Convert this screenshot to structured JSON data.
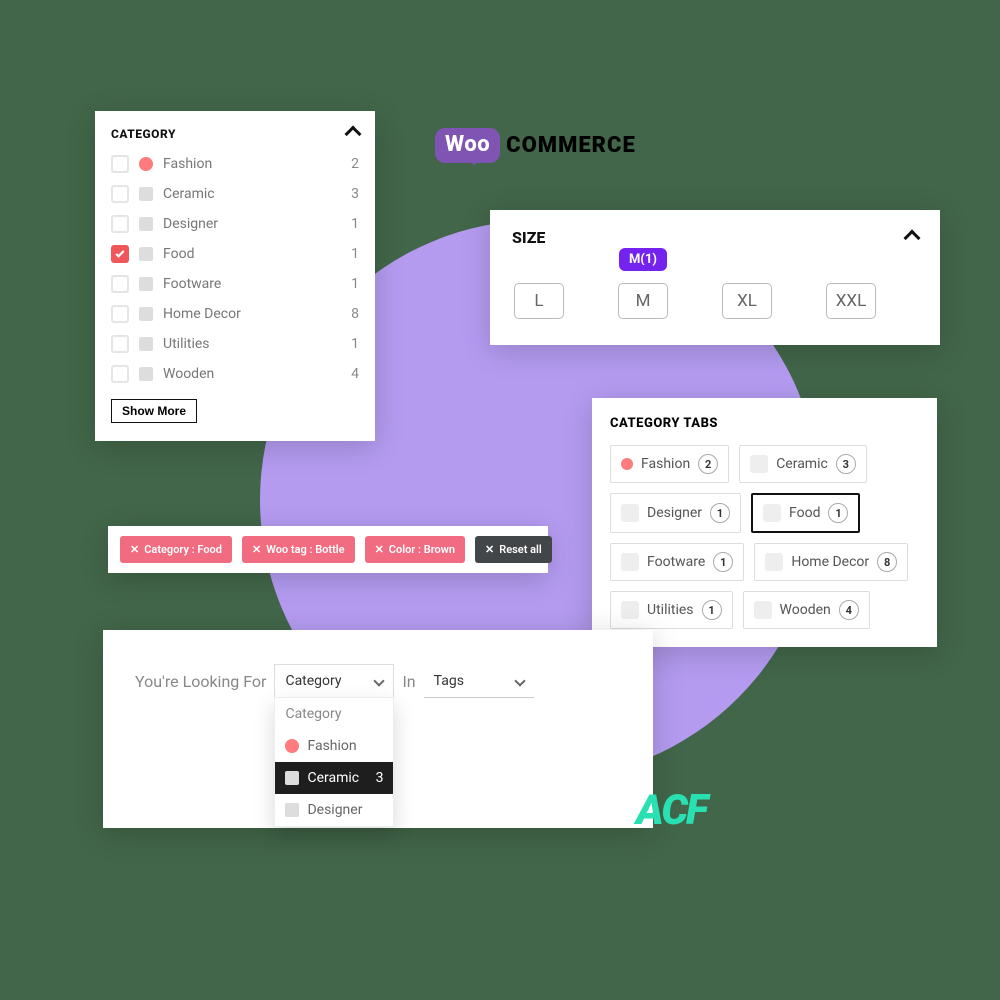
{
  "logos": {
    "woo_prefix": "Woo",
    "woo_suffix": "COMMERCE",
    "acf": "ACF"
  },
  "category": {
    "title": "CATEGORY",
    "show_more": "Show More",
    "items": [
      {
        "label": "Fashion",
        "count": "2",
        "checked": false,
        "dot": true
      },
      {
        "label": "Ceramic",
        "count": "3",
        "checked": false,
        "dot": false
      },
      {
        "label": "Designer",
        "count": "1",
        "checked": false,
        "dot": false
      },
      {
        "label": "Food",
        "count": "1",
        "checked": true,
        "dot": false
      },
      {
        "label": "Footware",
        "count": "1",
        "checked": false,
        "dot": false
      },
      {
        "label": "Home Decor",
        "count": "8",
        "checked": false,
        "dot": false
      },
      {
        "label": "Utilities",
        "count": "1",
        "checked": false,
        "dot": false
      },
      {
        "label": "Wooden",
        "count": "4",
        "checked": false,
        "dot": false
      }
    ]
  },
  "size": {
    "title": "SIZE",
    "tooltip": "M(1)",
    "options": [
      {
        "label": "L",
        "tip": false
      },
      {
        "label": "M",
        "tip": true
      },
      {
        "label": "XL",
        "tip": false
      },
      {
        "label": "XXL",
        "tip": false
      }
    ]
  },
  "tabs": {
    "title": "CATEGORY TABS",
    "items": [
      {
        "label": "Fashion",
        "count": "2",
        "active": false,
        "dot": true
      },
      {
        "label": "Ceramic",
        "count": "3",
        "active": false,
        "dot": false
      },
      {
        "label": "Designer",
        "count": "1",
        "active": false,
        "dot": false
      },
      {
        "label": "Food",
        "count": "1",
        "active": true,
        "dot": false
      },
      {
        "label": "Footware",
        "count": "1",
        "active": false,
        "dot": false
      },
      {
        "label": "Home Decor",
        "count": "8",
        "active": false,
        "dot": false
      },
      {
        "label": "Utilities",
        "count": "1",
        "active": false,
        "dot": false
      },
      {
        "label": "Wooden",
        "count": "4",
        "active": false,
        "dot": false
      }
    ]
  },
  "filters": {
    "chips": [
      {
        "label": "Category : Food"
      },
      {
        "label": "Woo tag : Bottle"
      },
      {
        "label": "Color : Brown"
      }
    ],
    "reset": "Reset all"
  },
  "looking": {
    "prefix": "You're Looking For",
    "mid": "In",
    "select1": {
      "value": "Category",
      "header": "Category",
      "options": [
        {
          "label": "Fashion",
          "count": "",
          "sel": false,
          "dot": true
        },
        {
          "label": "Ceramic",
          "count": "3",
          "sel": true,
          "dot": false
        },
        {
          "label": "Designer",
          "count": "",
          "sel": false,
          "dot": false
        }
      ]
    },
    "select2": {
      "value": "Tags"
    }
  }
}
